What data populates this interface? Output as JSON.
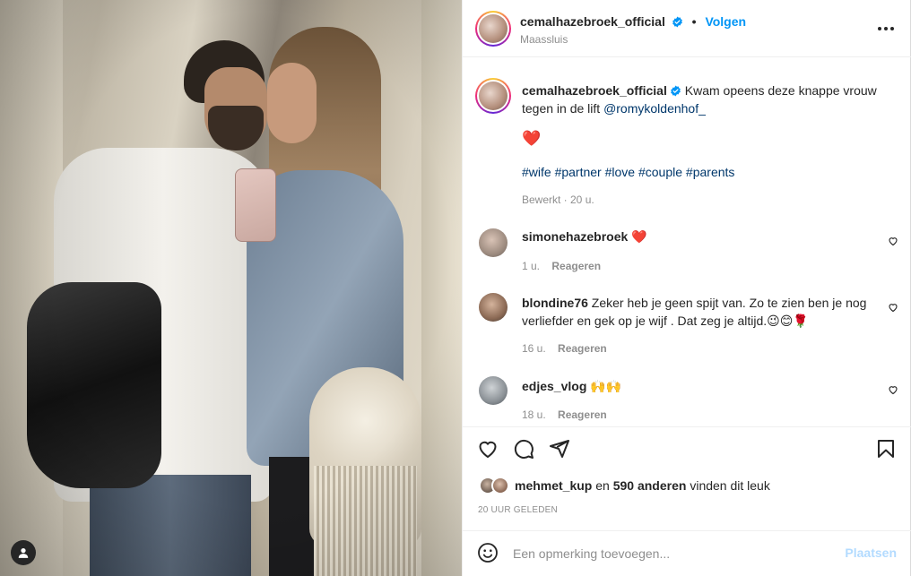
{
  "header": {
    "username": "cemalhazebroek_official",
    "verified_icon": "verified-badge-icon",
    "separator": "•",
    "follow_label": "Volgen",
    "location": "Maassluis",
    "more_icon": "more-options-icon"
  },
  "caption": {
    "username": "cemalhazebroek_official",
    "text_part1": "Kwam opeens deze knappe vrouw tegen in de lift ",
    "mention": "@romykoldenhof_",
    "emoji": "❤️",
    "hashtags": [
      "#wife",
      "#partner",
      "#love",
      "#couple",
      "#parents"
    ],
    "meta": "Bewerkt · 20 u."
  },
  "comments": [
    {
      "username": "simonehazebroek",
      "text": "❤️",
      "time": "1 u.",
      "reply": "Reageren"
    },
    {
      "username": "blondine76",
      "text": "Zeker heb je geen spijt van. Zo te zien ben je nog verliefder en gek op je wijf . Dat zeg je altijd.😉😊🌹",
      "time": "16 u.",
      "reply": "Reageren"
    },
    {
      "username": "edjes_vlog",
      "text": "🙌🙌",
      "time": "18 u.",
      "reply": "Reageren"
    }
  ],
  "likes": {
    "liker": "mehmet_kup",
    "and_text": "en",
    "others": "590 anderen",
    "suffix": "vinden dit leuk"
  },
  "timestamp": "20 UUR GELEDEN",
  "add_comment": {
    "placeholder": "Een opmerking toevoegen...",
    "post_label": "Plaatsen"
  },
  "colors": {
    "accent": "#0095f6",
    "link": "#00376b",
    "muted": "#8e8e8e",
    "post_disabled": "#b3dbff"
  }
}
